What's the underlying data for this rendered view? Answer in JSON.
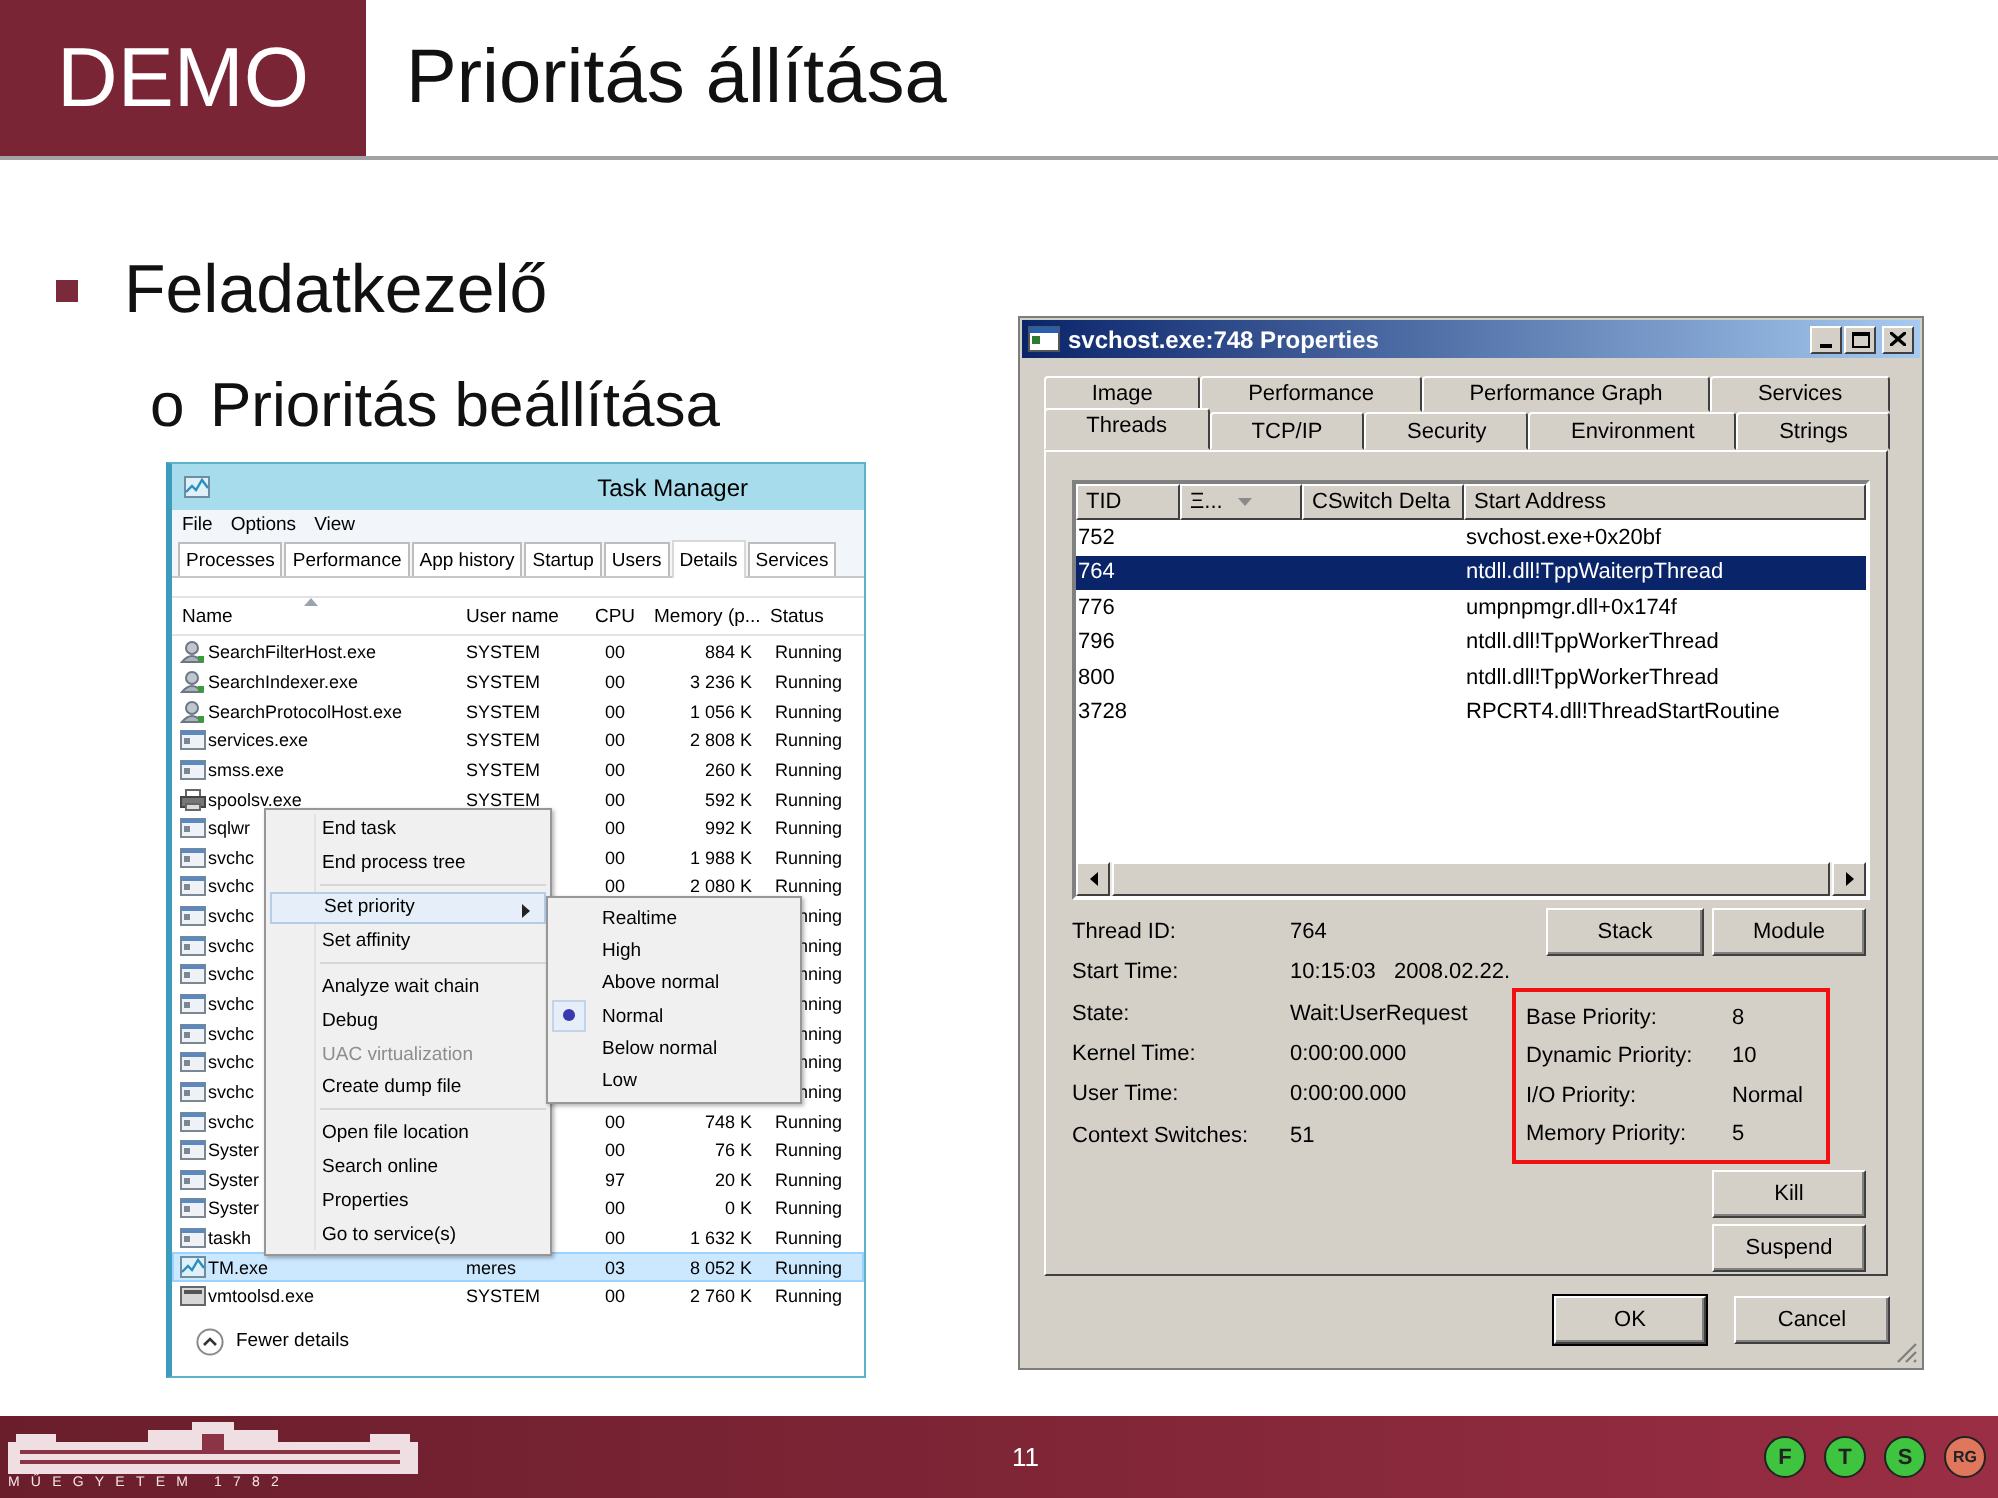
{
  "slide": {
    "badge": "DEMO",
    "title": "Prioritás állítása"
  },
  "bullets": [
    {
      "text": "Feladatkezelő",
      "children": [
        {
          "marker": "o",
          "text": "Prioritás beállítása"
        }
      ]
    }
  ],
  "task_manager": {
    "title": "Task Manager",
    "menu": [
      "File",
      "Options",
      "View"
    ],
    "tabs": [
      {
        "label": "Processes",
        "selected": false
      },
      {
        "label": "Performance",
        "selected": false
      },
      {
        "label": "App history",
        "selected": false
      },
      {
        "label": "Startup",
        "selected": false
      },
      {
        "label": "Users",
        "selected": false
      },
      {
        "label": "Details",
        "selected": true
      },
      {
        "label": "Services",
        "selected": false
      }
    ],
    "columns": [
      "Name",
      "User name",
      "CPU",
      "Memory (p...",
      "Status"
    ],
    "rows": [
      {
        "kind": "search",
        "name": "SearchFilterHost.exe",
        "user": "SYSTEM",
        "cpu": "00",
        "memory": "884 K",
        "status": "Running",
        "selected": false
      },
      {
        "kind": "search",
        "name": "SearchIndexer.exe",
        "user": "SYSTEM",
        "cpu": "00",
        "memory": "3 236 K",
        "status": "Running",
        "selected": false
      },
      {
        "kind": "search",
        "name": "SearchProtocolHost.exe",
        "user": "SYSTEM",
        "cpu": "00",
        "memory": "1 056 K",
        "status": "Running",
        "selected": false
      },
      {
        "kind": "app",
        "name": "services.exe",
        "user": "SYSTEM",
        "cpu": "00",
        "memory": "2 808 K",
        "status": "Running",
        "selected": false
      },
      {
        "kind": "app",
        "name": "smss.exe",
        "user": "SYSTEM",
        "cpu": "00",
        "memory": "260 K",
        "status": "Running",
        "selected": false
      },
      {
        "kind": "printer",
        "name": "spoolsv.exe",
        "user": "SYSTEM",
        "cpu": "00",
        "memory": "592 K",
        "status": "Running",
        "selected": false
      },
      {
        "kind": "app",
        "name": "sqlwr",
        "cpu": "00",
        "memory": "992 K",
        "status": "Running",
        "selected": false
      },
      {
        "kind": "app",
        "name": "svchc",
        "cpu": "00",
        "memory": "1 988 K",
        "status": "Running",
        "selected": false
      },
      {
        "kind": "app",
        "name": "svchc",
        "cpu": "00",
        "memory": "2 080 K",
        "status": "Running",
        "selected": false
      },
      {
        "kind": "app",
        "name": "svchc",
        "status": "nning",
        "selected": false
      },
      {
        "kind": "app",
        "name": "svchc",
        "status": "nning",
        "selected": false
      },
      {
        "kind": "app",
        "name": "svchc",
        "status": "nning",
        "selected": false
      },
      {
        "kind": "app",
        "name": "svchc",
        "status": "nning",
        "selected": false
      },
      {
        "kind": "app",
        "name": "svchc",
        "status": "nning",
        "selected": false
      },
      {
        "kind": "app",
        "name": "svchc",
        "status": "nning",
        "selected": false
      },
      {
        "kind": "app",
        "name": "svchc",
        "status": "nning",
        "selected": false
      },
      {
        "kind": "app",
        "name": "svchc",
        "cpu": "00",
        "memory": "748 K",
        "status": "Running",
        "selected": false
      },
      {
        "kind": "app",
        "name": "Syster",
        "cpu": "00",
        "memory": "76 K",
        "status": "Running",
        "selected": false
      },
      {
        "kind": "app",
        "name": "Syster",
        "cpu": "97",
        "memory": "20 K",
        "status": "Running",
        "selected": false
      },
      {
        "kind": "app",
        "name": "Syster",
        "cpu": "00",
        "memory": "0 K",
        "status": "Running",
        "selected": false
      },
      {
        "kind": "app",
        "name": "taskh",
        "cpu": "00",
        "memory": "1 632 K",
        "status": "Running",
        "selected": false
      },
      {
        "kind": "chart",
        "name": "TM.exe",
        "user": "meres",
        "cpu": "03",
        "memory": "8 052 K",
        "status": "Running",
        "selected": true
      },
      {
        "kind": "vm",
        "name": "vmtoolsd.exe",
        "user": "SYSTEM",
        "cpu": "00",
        "memory": "2 760 K",
        "status": "Running",
        "selected": false
      }
    ],
    "context_menu": {
      "groups": [
        {
          "items": [
            {
              "label": "End task",
              "highlighted": false,
              "disabled": false,
              "submenu": false
            },
            {
              "label": "End process tree",
              "highlighted": false,
              "disabled": false,
              "submenu": false
            }
          ]
        },
        {
          "items": [
            {
              "label": "Set priority",
              "highlighted": true,
              "disabled": false,
              "submenu": true
            },
            {
              "label": "Set affinity",
              "highlighted": false,
              "disabled": false,
              "submenu": false
            }
          ]
        },
        {
          "items": [
            {
              "label": "Analyze wait chain",
              "highlighted": false,
              "disabled": false,
              "submenu": false
            },
            {
              "label": "Debug",
              "highlighted": false,
              "disabled": false,
              "submenu": false
            },
            {
              "label": "UAC virtualization",
              "highlighted": false,
              "disabled": true,
              "submenu": false
            },
            {
              "label": "Create dump file",
              "highlighted": false,
              "disabled": false,
              "submenu": false
            }
          ]
        },
        {
          "items": [
            {
              "label": "Open file location",
              "highlighted": false,
              "disabled": false,
              "submenu": false
            },
            {
              "label": "Search online",
              "highlighted": false,
              "disabled": false,
              "submenu": false
            },
            {
              "label": "Properties",
              "highlighted": false,
              "disabled": false,
              "submenu": false
            },
            {
              "label": "Go to service(s)",
              "highlighted": false,
              "disabled": false,
              "submenu": false
            }
          ]
        }
      ],
      "submenu": [
        {
          "label": "Realtime",
          "selected": false
        },
        {
          "label": "High",
          "selected": false
        },
        {
          "label": "Above normal",
          "selected": false
        },
        {
          "label": "Normal",
          "selected": true
        },
        {
          "label": "Below normal",
          "selected": false
        },
        {
          "label": "Low",
          "selected": false
        }
      ]
    },
    "footer": "Fewer details"
  },
  "properties": {
    "title": "svchost.exe:748 Properties",
    "tab_rows": [
      [
        {
          "label": "Image",
          "selected": false
        },
        {
          "label": "Performance",
          "selected": false
        },
        {
          "label": "Performance Graph",
          "selected": false
        },
        {
          "label": "Services",
          "selected": false
        }
      ],
      [
        {
          "label": "Threads",
          "selected": true
        },
        {
          "label": "TCP/IP",
          "selected": false
        },
        {
          "label": "Security",
          "selected": false
        },
        {
          "label": "Environment",
          "selected": false
        },
        {
          "label": "Strings",
          "selected": false
        }
      ]
    ],
    "columns": [
      "TID",
      "Ξ...",
      "CSwitch Delta",
      "Start Address"
    ],
    "threads": [
      {
        "tid": "752",
        "start_address": "svchost.exe+0x20bf",
        "selected": false
      },
      {
        "tid": "764",
        "start_address": "ntdll.dll!TppWaiterpThread",
        "selected": true
      },
      {
        "tid": "776",
        "start_address": "umpnpmgr.dll+0x174f",
        "selected": false
      },
      {
        "tid": "796",
        "start_address": "ntdll.dll!TppWorkerThread",
        "selected": false
      },
      {
        "tid": "800",
        "start_address": "ntdll.dll!TppWorkerThread",
        "selected": false
      },
      {
        "tid": "3728",
        "start_address": "RPCRT4.dll!ThreadStartRoutine",
        "selected": false
      }
    ],
    "details": [
      {
        "label": "Thread ID:",
        "value": "764"
      },
      {
        "label": "Start Time:",
        "value": "10:15:03   2008.02.22."
      },
      {
        "label": "State:",
        "value": "Wait:UserRequest"
      },
      {
        "label": "Kernel Time:",
        "value": "0:00:00.000"
      },
      {
        "label": "User Time:",
        "value": "0:00:00.000"
      },
      {
        "label": "Context Switches:",
        "value": "51"
      }
    ],
    "priorities": [
      {
        "label": "Base Priority:",
        "value": "8"
      },
      {
        "label": "Dynamic Priority:",
        "value": "10"
      },
      {
        "label": "I/O Priority:",
        "value": "Normal"
      },
      {
        "label": "Memory Priority:",
        "value": "5"
      }
    ],
    "thread_buttons": [
      "Stack",
      "Module"
    ],
    "action_buttons": [
      "Kill",
      "Suspend"
    ],
    "dialog_buttons": [
      {
        "label": "OK",
        "default": true
      },
      {
        "label": "Cancel",
        "default": false
      }
    ]
  },
  "footer": {
    "university": "MŰEGYETEM 1782",
    "page": "11",
    "logos": [
      {
        "letter": "F",
        "color": "#3fc43f"
      },
      {
        "letter": "T",
        "color": "#3fc43f"
      },
      {
        "letter": "S",
        "color": "#3fc43f"
      },
      {
        "letter": "RG",
        "color": "#e0765c"
      }
    ]
  }
}
